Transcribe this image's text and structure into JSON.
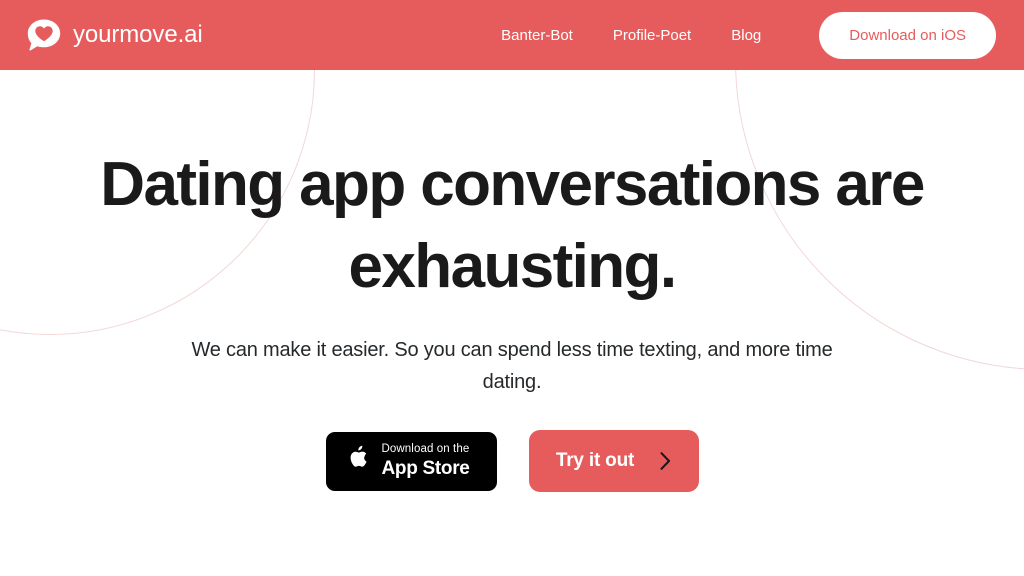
{
  "header": {
    "brand": {
      "name": "yourmove.ai",
      "icon": "heart-speech-bubble-icon",
      "bg_color": "#e65c5c",
      "text_color": "#ffffff"
    },
    "nav_items": [
      {
        "label": "Banter-Bot"
      },
      {
        "label": "Profile-Poet"
      },
      {
        "label": "Blog"
      }
    ],
    "cta": {
      "label": "Download on iOS",
      "bg_color": "#ffffff",
      "text_color": "#e65c5c"
    }
  },
  "hero": {
    "title": "Dating app conversations are exhausting.",
    "subtitle": "We can make it easier. So you can spend less time texting, and more time dating.",
    "title_color": "#1a1a1a",
    "appstore": {
      "icon": "apple-logo-icon",
      "top_label": "Download on the",
      "bottom_label": "App Store",
      "bg_color": "#000000"
    },
    "try_button": {
      "label": "Try it out",
      "icon": "chevron-right-icon",
      "bg_color": "#e65c5c",
      "text_color": "#ffffff"
    }
  },
  "decor": {
    "circle_stroke_color": "#f3d7d7"
  }
}
